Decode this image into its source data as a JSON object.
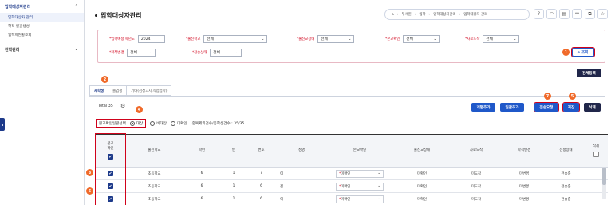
{
  "sidebar": {
    "groups": [
      {
        "label": "입학대상자관리",
        "items": [
          "입학대상자 관리",
          "학적 일괄생성",
          "입학자현황조회"
        ]
      },
      {
        "label": "진학관리",
        "items": []
      }
    ]
  },
  "header": {
    "title": "입학대상자관리",
    "breadcrumb": [
      "부서원",
      "입학",
      "입학대상자관리",
      "입학대상자 관리"
    ]
  },
  "search": {
    "fields": [
      {
        "label": "*입학예정 학년도",
        "value": "2024"
      },
      {
        "label": "*출신학교",
        "value": "전체"
      },
      {
        "label": "*출신교상태",
        "value": "전체"
      },
      {
        "label": "*본교확인",
        "value": "전체"
      },
      {
        "label": "*자료도착",
        "value": "전체"
      },
      {
        "label": "*학적변경",
        "value": "전체"
      },
      {
        "label": "*전송상태",
        "value": "전체"
      }
    ],
    "search_button": "조회",
    "clear_button": "전체등록"
  },
  "tabs": [
    "재학생",
    "졸업생",
    "기타(검정고시,직업업학)"
  ],
  "total_label": "Total 35",
  "filter": {
    "label": "본교확인일괄선택",
    "options": [
      "대상",
      "비대상",
      "미확인"
    ],
    "selected": 0,
    "count_text": "중복제외건수/총학생건수 : 35/35"
  },
  "actions": {
    "add": "개별추가",
    "bulk_add": "일괄추가",
    "transfer": "전송요청",
    "save": "저장",
    "delete": "삭제"
  },
  "badges": [
    "1",
    "2",
    "3",
    "4",
    "5",
    "6",
    "7"
  ],
  "table": {
    "headers": [
      "본교\n확인",
      "출신학교",
      "학년",
      "반",
      "번호",
      "성명",
      "본교확인",
      "출신교상태",
      "자료도착",
      "학적변경",
      "전송상태",
      "삭제"
    ],
    "rows": [
      [
        "초등학교",
        "6",
        "1",
        "7",
        "이",
        "미확인",
        "미확인",
        "미도착",
        "미변경",
        "전송중"
      ],
      [
        "초등학교",
        "6",
        "1",
        "6",
        "김",
        "미확인",
        "미확인",
        "미도착",
        "미변경",
        "전송중"
      ],
      [
        "초등학교",
        "6",
        "1",
        "6",
        "이",
        "미확인",
        "미확인",
        "미도착",
        "미변경",
        "전송중"
      ]
    ]
  },
  "colors": {
    "primary": "#1f58c9",
    "dark": "#20264a",
    "required": "#d0021b",
    "badge": "#f06a2a"
  }
}
